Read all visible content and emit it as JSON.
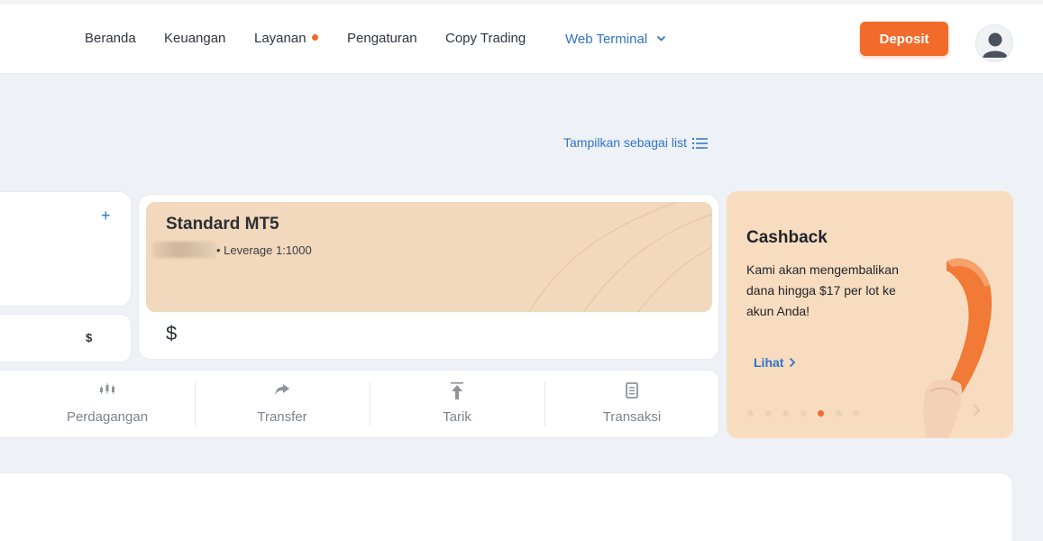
{
  "header": {
    "nav": [
      {
        "label": "Beranda"
      },
      {
        "label": "Keuangan"
      },
      {
        "label": "Layanan",
        "has_dot": true
      },
      {
        "label": "Pengaturan"
      },
      {
        "label": "Copy Trading"
      },
      {
        "label": "Web Terminal",
        "dropdown": true
      }
    ],
    "deposit_label": "Deposit",
    "avatar_icon": "user-avatar-icon"
  },
  "view_toggle": {
    "label": "Tampilkan sebagai list",
    "icon": "list-icon"
  },
  "accounts": {
    "add_icon": "+",
    "left_currency": "$",
    "card": {
      "title": "Standard MT5",
      "leverage": "• Leverage 1:1000",
      "currency": "$"
    }
  },
  "actions": [
    {
      "label": "Perdagangan",
      "icon": "candlestick-icon"
    },
    {
      "label": "Transfer",
      "icon": "share-arrow-icon"
    },
    {
      "label": "Tarik",
      "icon": "withdraw-arrow-icon"
    },
    {
      "label": "Transaksi",
      "icon": "document-icon"
    }
  ],
  "promo": {
    "title": "Cashback",
    "text": "Kami akan mengembalikan dana hingga $17 per lot ke akun Anda!",
    "link": "Lihat",
    "slides_total": 7,
    "active_slide": 5
  },
  "colors": {
    "accent": "#f26b2a",
    "link": "#2f74c9",
    "card_peach": "#f2d8bc",
    "promo_bg": "#f8dcc0"
  }
}
